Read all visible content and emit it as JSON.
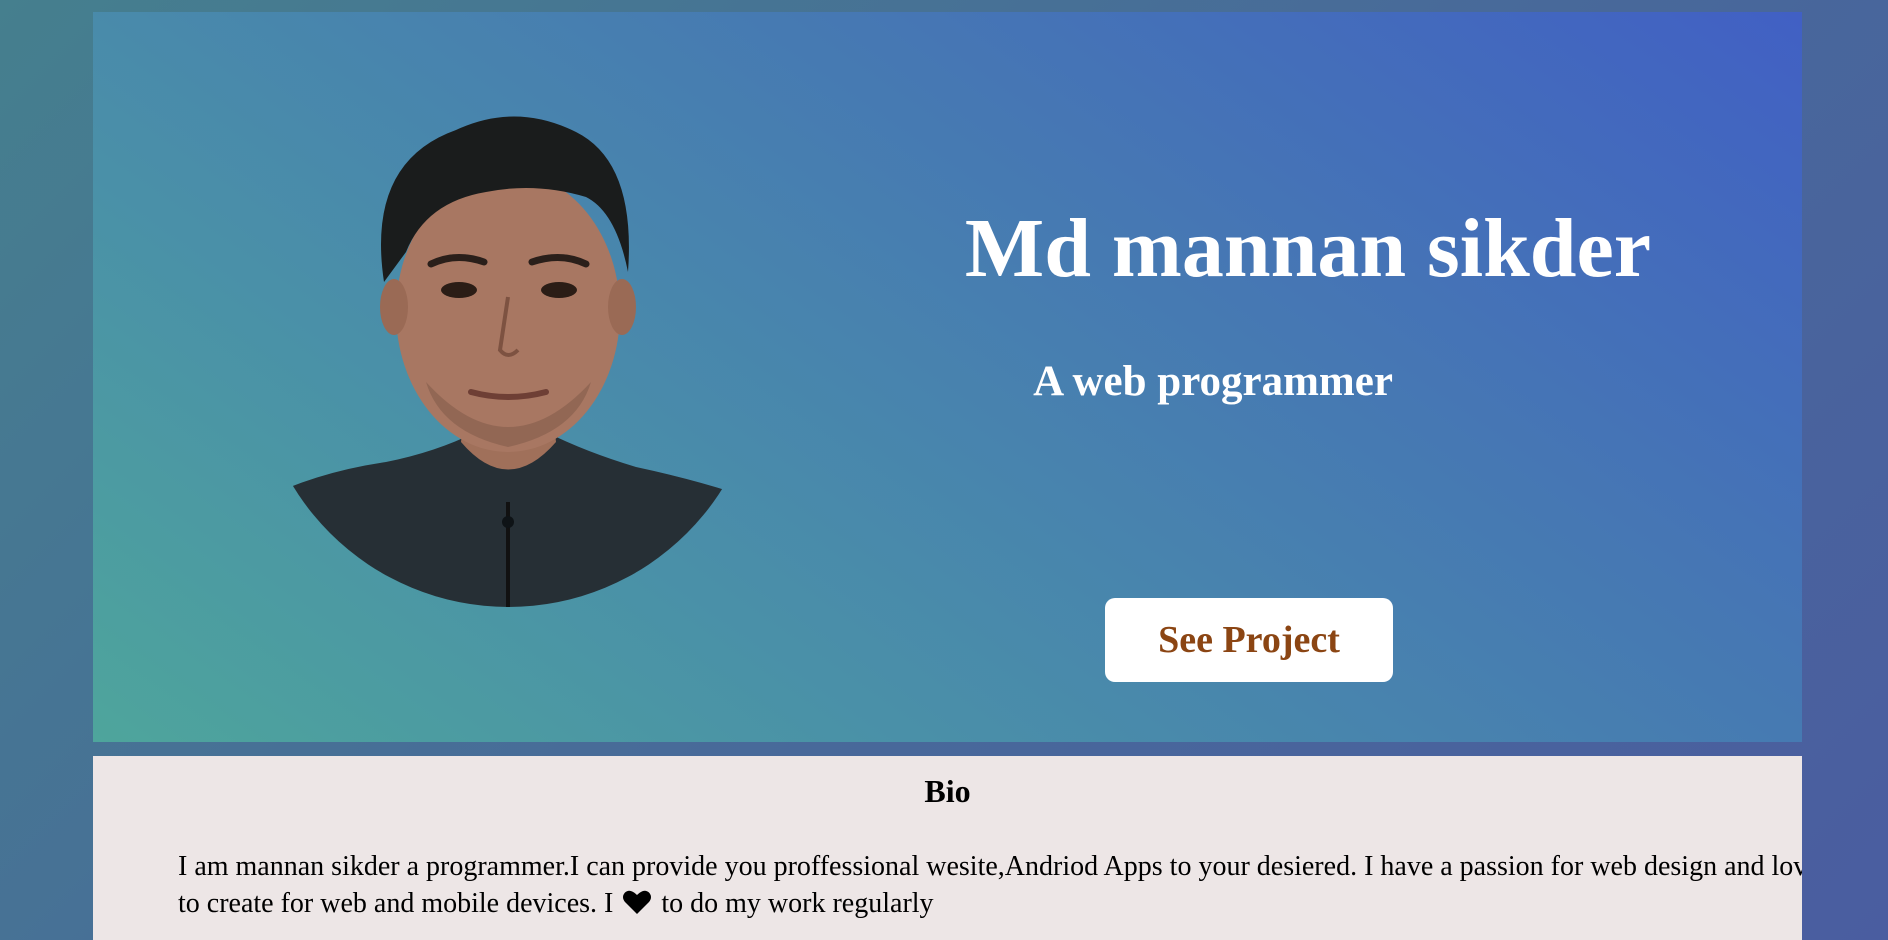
{
  "hero": {
    "name": "Md mannan sikder",
    "tagline": "A web programmer",
    "button_label": "See Project"
  },
  "avatar": {
    "icon": "profile-photo"
  },
  "bio": {
    "title": "Bio",
    "text_before_icon": "I am mannan sikder a programmer.I can provide you proffessional wesite,Andriod Apps to your desiered. I have a passion for web design and love to create for web and mobile devices. I ",
    "icon": "heart-icon",
    "text_after_icon": " to do my work regularly"
  },
  "colors": {
    "button_text": "#8b4513",
    "bio_background": "#ede6e6",
    "hero_gradient_start": "#4ea59c",
    "hero_gradient_end": "#4160c4"
  }
}
